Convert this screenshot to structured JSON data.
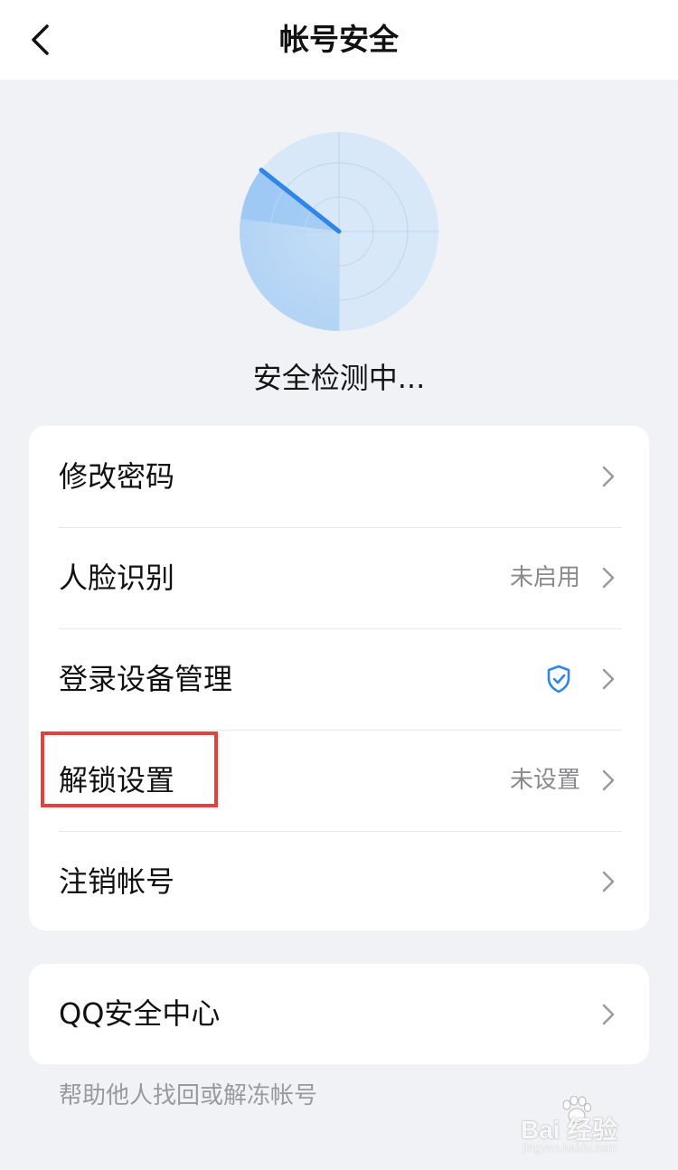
{
  "header": {
    "title": "帐号安全",
    "back_icon": "chevron-left-icon"
  },
  "scan": {
    "status_text": "安全检测中...",
    "radar_color": "#2f86e8"
  },
  "settings": {
    "items": [
      {
        "label": "修改密码",
        "value": ""
      },
      {
        "label": "人脸识别",
        "value": "未启用"
      },
      {
        "label": "登录设备管理",
        "value": "",
        "icon": "shield-check-icon"
      },
      {
        "label": "解锁设置",
        "value": "未设置",
        "highlighted": true
      },
      {
        "label": "注销帐号",
        "value": ""
      }
    ]
  },
  "qq_security": {
    "label": "QQ安全中心",
    "help_text": "帮助他人找回或解冻帐号"
  },
  "watermark": {
    "logo_text": "Bai 经验",
    "url": "jingyan.baidu.com"
  },
  "colors": {
    "accent_blue": "#2f86e8",
    "highlight_red": "#e2413d",
    "background": "#f1f2f6"
  }
}
